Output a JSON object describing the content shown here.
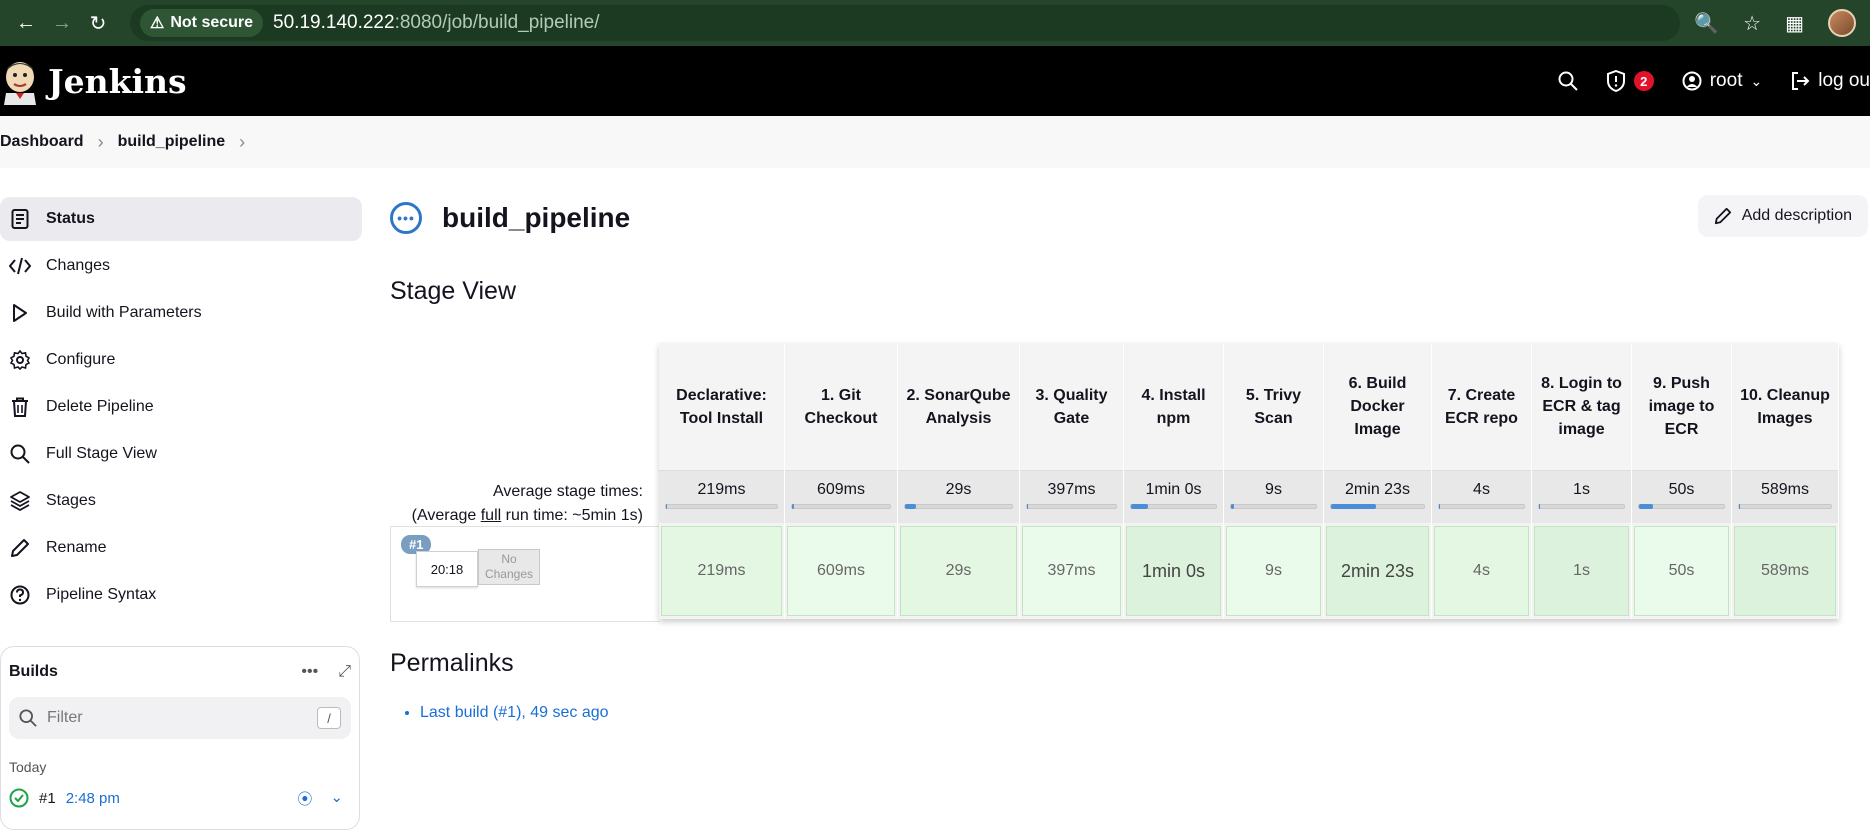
{
  "browser": {
    "security_label": "Not secure",
    "url_host": "50.19.140.222",
    "url_rest": ":8080/job/build_pipeline/"
  },
  "header": {
    "logo_text": "Jenkins",
    "alerts_count": "2",
    "user": "root",
    "logout": "log ou"
  },
  "breadcrumb": [
    "Dashboard",
    "build_pipeline"
  ],
  "sidebar": {
    "items": [
      {
        "label": "Status",
        "icon": "document-icon"
      },
      {
        "label": "Changes",
        "icon": "code-icon"
      },
      {
        "label": "Build with Parameters",
        "icon": "play-icon"
      },
      {
        "label": "Configure",
        "icon": "gear-icon"
      },
      {
        "label": "Delete Pipeline",
        "icon": "trash-icon"
      },
      {
        "label": "Full Stage View",
        "icon": "search-icon"
      },
      {
        "label": "Stages",
        "icon": "layers-icon"
      },
      {
        "label": "Rename",
        "icon": "pencil-icon"
      },
      {
        "label": "Pipeline Syntax",
        "icon": "help-icon"
      }
    ]
  },
  "builds": {
    "title": "Builds",
    "filter_placeholder": "Filter",
    "filter_shortcut": "/",
    "group": "Today",
    "entries": [
      {
        "number": "#1",
        "time": "2:48 pm"
      }
    ]
  },
  "main": {
    "title": "build_pipeline",
    "add_description": "Add description",
    "stage_view_title": "Stage View",
    "avg_stage_times": "Average stage times:",
    "avg_full_prefix": "(Average ",
    "avg_full_word": "full",
    "avg_full_suffix": " run time: ~5min 1s)",
    "run": {
      "badge": "#1",
      "time": "20:18",
      "changes": "No Changes"
    },
    "permalinks_title": "Permalinks",
    "permalinks": [
      "Last build (#1), 49 sec ago"
    ]
  },
  "stages": [
    {
      "name": "Declarative: Tool Install",
      "avg": "219ms",
      "run": "219ms",
      "bar": 0.01
    },
    {
      "name": "1. Git Checkout",
      "avg": "609ms",
      "run": "609ms",
      "bar": 0.02
    },
    {
      "name": "2. SonarQube Analysis",
      "avg": "29s",
      "run": "29s",
      "bar": 0.1
    },
    {
      "name": "3. Quality Gate",
      "avg": "397ms",
      "run": "397ms",
      "bar": 0.01
    },
    {
      "name": "4. Install npm",
      "avg": "1min 0s",
      "run": "1min 0s",
      "bar": 0.2
    },
    {
      "name": "5. Trivy Scan",
      "avg": "9s",
      "run": "9s",
      "bar": 0.03
    },
    {
      "name": "6. Build Docker Image",
      "avg": "2min 23s",
      "run": "2min 23s",
      "bar": 0.48
    },
    {
      "name": "7. Create ECR repo",
      "avg": "4s",
      "run": "4s",
      "bar": 0.01
    },
    {
      "name": "8. Login to ECR & tag image",
      "avg": "1s",
      "run": "1s",
      "bar": 0.005
    },
    {
      "name": "9. Push image to ECR",
      "avg": "50s",
      "run": "50s",
      "bar": 0.17
    },
    {
      "name": "10. Cleanup Images",
      "avg": "589ms",
      "run": "589ms",
      "bar": 0.01
    }
  ],
  "colors": {
    "chrome_bg": "#24452a",
    "header_bg": "#000000",
    "link": "#1a6fd6",
    "success_cell": "#e3f7e3",
    "alert_badge": "#e3122b"
  }
}
